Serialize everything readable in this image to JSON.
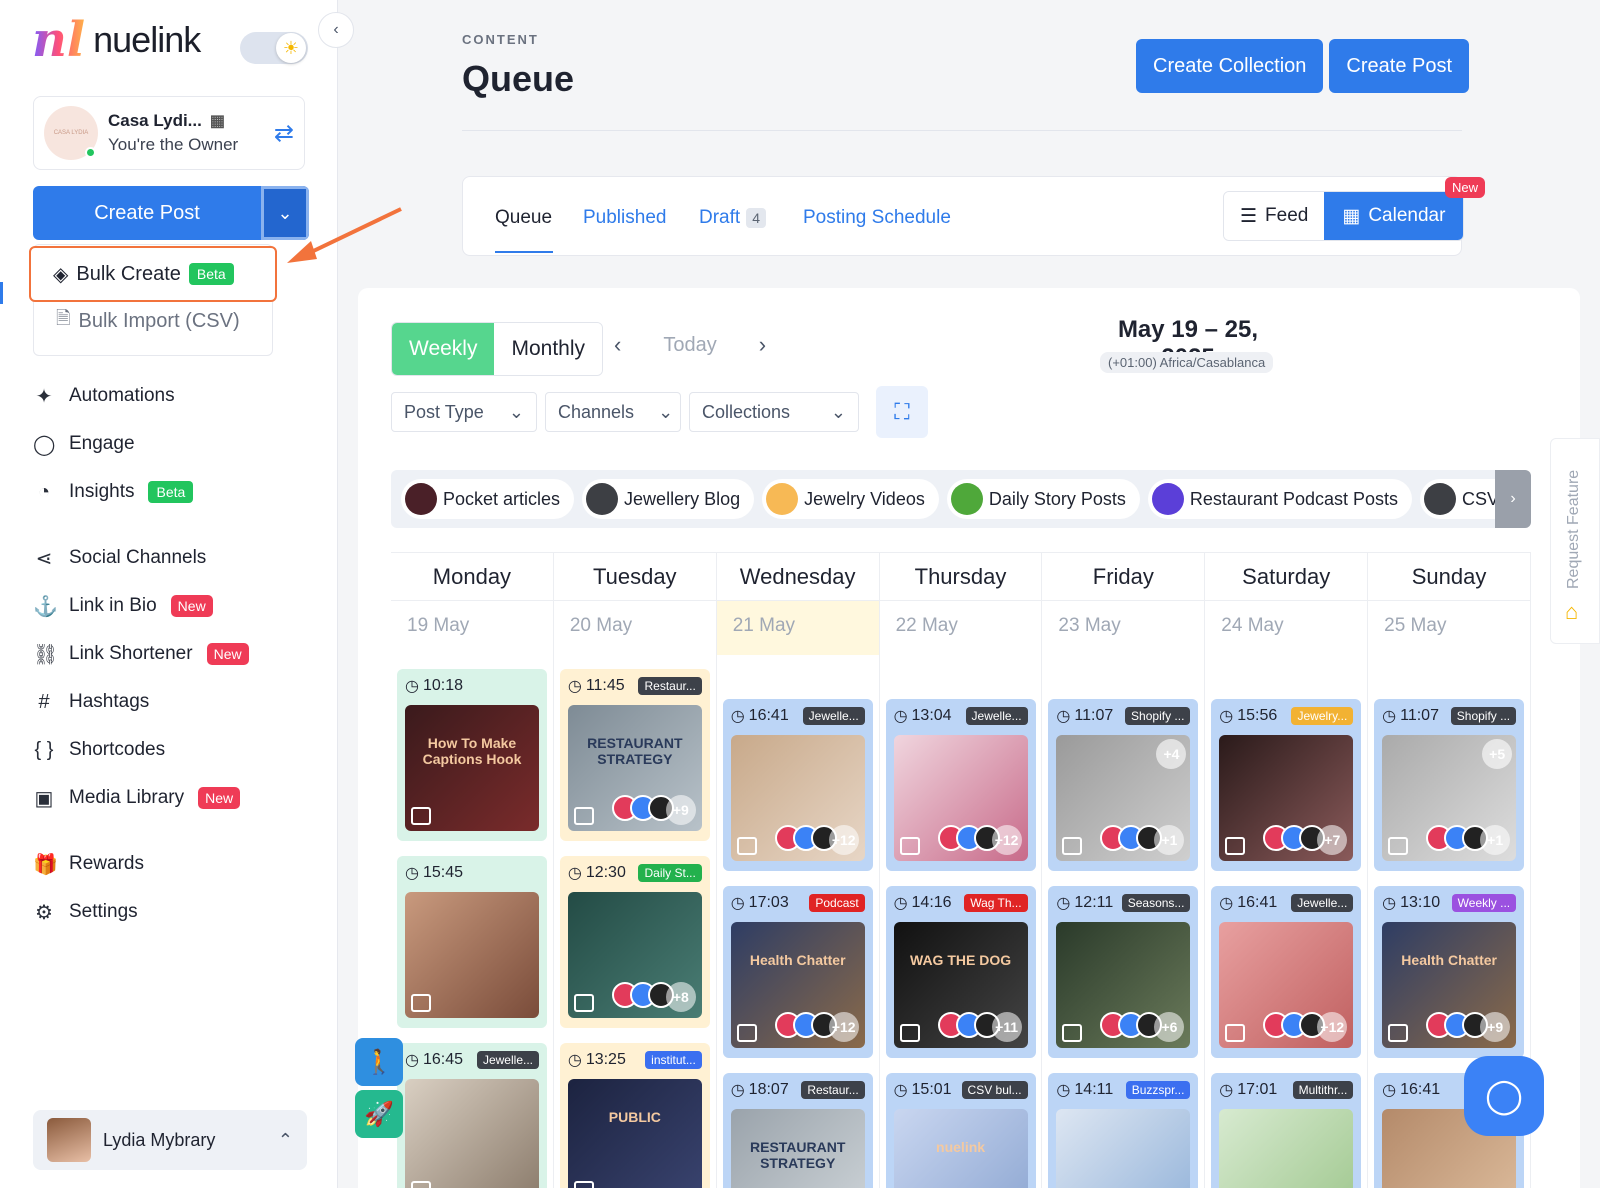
{
  "brand": {
    "logo_mark": "nl",
    "logo_text": "nuelink"
  },
  "account": {
    "name": "Casa Lydi...",
    "role": "You're the Owner",
    "avatar_caption": "CASA LYDIA"
  },
  "sidebar": {
    "create_post": "Create Post",
    "bulk_create": "Bulk Create",
    "bulk_create_badge": "Beta",
    "bulk_import": "Bulk Import (CSV)",
    "items": [
      {
        "label": "Automations",
        "icon": "magic-wand-icon",
        "glyph": "✦"
      },
      {
        "label": "Engage",
        "icon": "chat-bubble-icon",
        "glyph": "◯"
      },
      {
        "label": "Insights",
        "icon": "pie-chart-icon",
        "glyph": "◔",
        "badge": "Beta"
      },
      {
        "label": "Social Channels",
        "icon": "share-icon",
        "glyph": "⋖"
      },
      {
        "label": "Link in Bio",
        "icon": "anchor-icon",
        "glyph": "⚓",
        "badge": "New"
      },
      {
        "label": "Link Shortener",
        "icon": "link-icon",
        "glyph": "⛓",
        "badge": "New"
      },
      {
        "label": "Hashtags",
        "icon": "hashtag-icon",
        "glyph": "#"
      },
      {
        "label": "Shortcodes",
        "icon": "braces-icon",
        "glyph": "{ }"
      },
      {
        "label": "Media Library",
        "icon": "image-gallery-icon",
        "glyph": "▣",
        "badge": "New"
      },
      {
        "label": "Rewards",
        "icon": "gift-icon",
        "glyph": "🎁"
      },
      {
        "label": "Settings",
        "icon": "gear-icon",
        "glyph": "⚙"
      }
    ],
    "user_name": "Lydia Mybrary"
  },
  "header": {
    "eyebrow": "CONTENT",
    "title": "Queue",
    "create_collection": "Create Collection",
    "create_post": "Create Post"
  },
  "tabs": {
    "queue": "Queue",
    "published": "Published",
    "draft": "Draft",
    "draft_count": "4",
    "posting_schedule": "Posting Schedule",
    "feed": "Feed",
    "calendar": "Calendar",
    "calendar_badge": "New"
  },
  "calendar": {
    "weekly": "Weekly",
    "monthly": "Monthly",
    "today": "Today",
    "date_range": "May 19 – 25, 2025",
    "timezone": "(+01:00) Africa/Casablanca",
    "filters": [
      "Post Type",
      "Channels",
      "Collections"
    ],
    "collections": [
      {
        "label": "Pocket articles",
        "color": "#4a2028"
      },
      {
        "label": "Jewellery Blog",
        "color": "#3d3f44"
      },
      {
        "label": "Jewelry Videos",
        "color": "#f7b955"
      },
      {
        "label": "Daily Story Posts",
        "color": "#4fa83a"
      },
      {
        "label": "Restaurant Podcast Posts",
        "color": "#5b3fd8"
      },
      {
        "label": "CSV bul",
        "color": "#3d3f44"
      }
    ],
    "days": [
      {
        "name": "Monday",
        "date": "19 May"
      },
      {
        "name": "Tuesday",
        "date": "20 May"
      },
      {
        "name": "Wednesday",
        "date": "21 May"
      },
      {
        "name": "Thursday",
        "date": "22 May"
      },
      {
        "name": "Friday",
        "date": "23 May"
      },
      {
        "name": "Saturday",
        "date": "24 May"
      },
      {
        "name": "Sunday",
        "date": "25 May"
      }
    ],
    "posts": {
      "mon": [
        {
          "time": "10:18",
          "tag": "",
          "thumb_text": "How To Make Captions Hook"
        },
        {
          "time": "15:45",
          "tag": ""
        },
        {
          "time": "16:45",
          "tag": "Jewelle..."
        }
      ],
      "tue": [
        {
          "time": "11:45",
          "tag": "Restaur...",
          "thumb_text": "RESTAURANT STRATEGY",
          "more": "+9"
        },
        {
          "time": "12:30",
          "tag": "Daily St...",
          "more": "+8"
        },
        {
          "time": "13:25",
          "tag": "institut...",
          "thumb_text": "PUBLIC"
        }
      ],
      "wed": [
        {
          "time": "16:41",
          "tag": "Jewelle...",
          "more": "+12"
        },
        {
          "time": "17:03",
          "tag": "Podcast",
          "thumb_text": "Health Chatter",
          "more": "+12"
        },
        {
          "time": "18:07",
          "tag": "Restaur...",
          "thumb_text": "RESTAURANT STRATEGY"
        }
      ],
      "thu": [
        {
          "time": "13:04",
          "tag": "Jewelle...",
          "more": "+12"
        },
        {
          "time": "14:16",
          "tag": "Wag Th...",
          "thumb_text": "WAG THE DOG",
          "more": "+11"
        },
        {
          "time": "15:01",
          "tag": "CSV bul...",
          "thumb_text": "nuelink"
        }
      ],
      "fri": [
        {
          "time": "11:07",
          "tag": "Shopify ...",
          "more": "+1",
          "extra": "+4"
        },
        {
          "time": "12:11",
          "tag": "Seasons...",
          "more": "+6"
        },
        {
          "time": "14:11",
          "tag": "Buzzspr..."
        }
      ],
      "sat": [
        {
          "time": "15:56",
          "tag": "Jewelry...",
          "more": "+7"
        },
        {
          "time": "16:41",
          "tag": "Jewelle...",
          "more": "+12"
        },
        {
          "time": "17:01",
          "tag": "Multithr..."
        }
      ],
      "sun": [
        {
          "time": "11:07",
          "tag": "Shopify ...",
          "more": "+1",
          "extra": "+5"
        },
        {
          "time": "13:10",
          "tag": "Weekly ...",
          "thumb_text": "Health Chatter",
          "more": "+9"
        },
        {
          "time": "16:41",
          "tag": ""
        }
      ]
    }
  },
  "request_feature": "Request Feature"
}
